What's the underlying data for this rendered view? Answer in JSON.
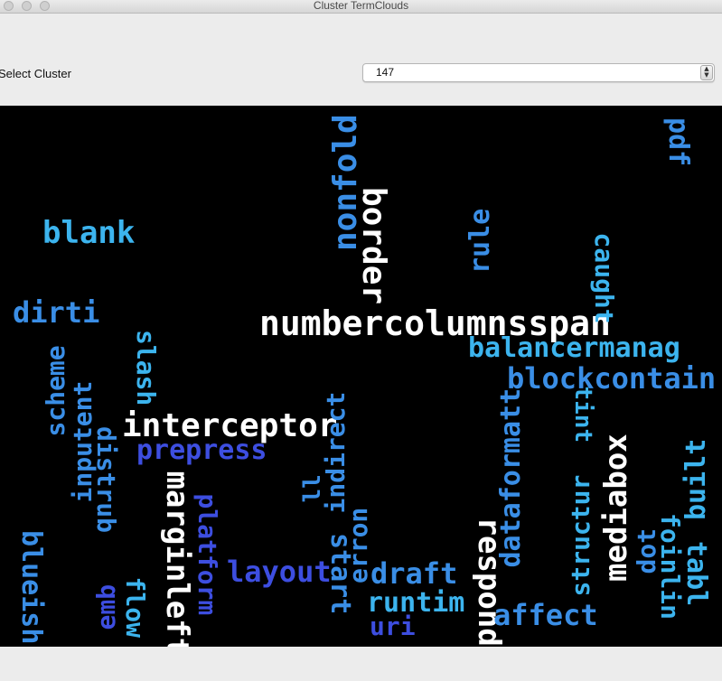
{
  "window": {
    "title": "Cluster TermClouds"
  },
  "controls": {
    "select_label": "Select Cluster",
    "selected_cluster": "147"
  },
  "colors": {
    "white": "#ffffff",
    "sky": "#3cb4ee",
    "mid": "#3a8ee6",
    "indigo": "#3d4ee0"
  },
  "cloud": {
    "words": [
      {
        "text": "numbercolumnsspan",
        "color": "white"
      },
      {
        "text": "interceptor",
        "color": "white"
      },
      {
        "text": "border",
        "color": "white"
      },
      {
        "text": "marginleft",
        "color": "white"
      },
      {
        "text": "respond",
        "color": "white"
      },
      {
        "text": "mediabox",
        "color": "white"
      },
      {
        "text": "blank",
        "color": "sky"
      },
      {
        "text": "dirti",
        "color": "mid"
      },
      {
        "text": "nonfold",
        "color": "mid"
      },
      {
        "text": "rule",
        "color": "mid"
      },
      {
        "text": "caught",
        "color": "sky"
      },
      {
        "text": "pdf",
        "color": "mid"
      },
      {
        "text": "balancermanag",
        "color": "sky"
      },
      {
        "text": "blockcontain",
        "color": "mid"
      },
      {
        "text": "slash",
        "color": "sky"
      },
      {
        "text": "scheme",
        "color": "mid"
      },
      {
        "text": "inputent",
        "color": "mid"
      },
      {
        "text": "distrub",
        "color": "mid"
      },
      {
        "text": "prepress",
        "color": "indigo"
      },
      {
        "text": "platform",
        "color": "indigo"
      },
      {
        "text": "layout",
        "color": "indigo"
      },
      {
        "text": "ll",
        "color": "mid"
      },
      {
        "text": "indirect",
        "color": "mid"
      },
      {
        "text": "start",
        "color": "mid"
      },
      {
        "text": "erron",
        "color": "mid"
      },
      {
        "text": "draft",
        "color": "mid"
      },
      {
        "text": "runtim",
        "color": "sky"
      },
      {
        "text": "uri",
        "color": "indigo"
      },
      {
        "text": "dataformatt",
        "color": "mid"
      },
      {
        "text": "affect",
        "color": "mid"
      },
      {
        "text": "structur",
        "color": "sky"
      },
      {
        "text": "tint",
        "color": "sky"
      },
      {
        "text": "built",
        "color": "sky"
      },
      {
        "text": "dot",
        "color": "mid"
      },
      {
        "text": "tabl",
        "color": "sky"
      },
      {
        "text": "foinlin",
        "color": "sky"
      },
      {
        "text": "blueish",
        "color": "mid"
      },
      {
        "text": "emb",
        "color": "indigo"
      },
      {
        "text": "flow",
        "color": "sky"
      }
    ]
  }
}
